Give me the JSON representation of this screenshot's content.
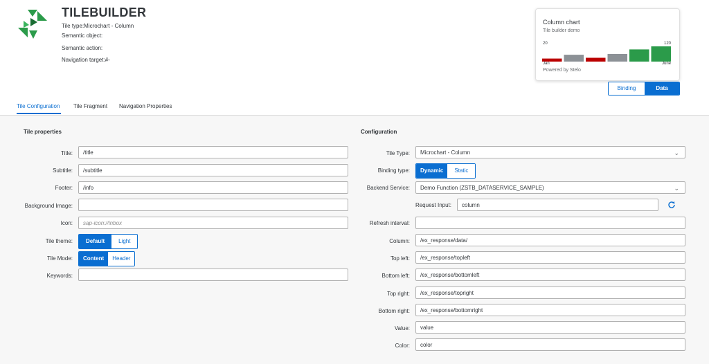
{
  "app": {
    "title": "TILEBUILDER",
    "tile_type": "Tile type:Microchart - Column",
    "semantic_object": "Semantic object:",
    "semantic_action": "Semantic action:",
    "navigation_target": "Navigation target:#-"
  },
  "preview": {
    "title": "Column chart",
    "subtitle": "Tile builder demo",
    "top_left": "20",
    "top_right": "120",
    "bottom_left": "Jan",
    "bottom_right": "June",
    "footer": "Powered by Stelo"
  },
  "chart_data": {
    "type": "bar",
    "values": [
      20,
      45,
      25,
      50,
      80,
      100
    ],
    "colors": [
      "#bb0000",
      "#8c9196",
      "#bb0000",
      "#8c9196",
      "#2b9b4a",
      "#2b9b4a"
    ],
    "ylim": [
      0,
      100
    ]
  },
  "view_toggle": {
    "binding": "Binding",
    "data": "Data",
    "selected": "Data"
  },
  "tabs": [
    {
      "label": "Tile Configuration",
      "active": true
    },
    {
      "label": "Tile Fragment",
      "active": false
    },
    {
      "label": "Navigation Properties",
      "active": false
    }
  ],
  "tile_properties": {
    "section_title": "Tile properties",
    "title_label": "Title:",
    "title_value": "/title",
    "subtitle_label": "Subtitle:",
    "subtitle_value": "/subtitle",
    "footer_label": "Footer:",
    "footer_value": "/info",
    "bg_image_label": "Background Image:",
    "bg_image_value": "",
    "icon_label": "Icon:",
    "icon_placeholder": "sap-icon://inbox",
    "theme_label": "Tile theme:",
    "theme_default": "Default",
    "theme_light": "Light",
    "mode_label": "Tile Mode:",
    "mode_content": "Content",
    "mode_header": "Header",
    "keywords_label": "Keywords:",
    "keywords_value": ""
  },
  "configuration": {
    "section_title": "Configuration",
    "tile_type_label": "Tile Type:",
    "tile_type_value": "Microchart - Column",
    "binding_type_label": "Binding type:",
    "binding_dynamic": "Dynamic",
    "binding_static": "Static",
    "backend_label": "Backend Service:",
    "backend_value": "Demo Function (ZSTB_DATASERVICE_SAMPLE)",
    "request_input_label": "Request Input:",
    "request_input_value": "column",
    "refresh_label": "Refresh interval:",
    "refresh_value": "",
    "column_label": "Column:",
    "column_value": "/ex_response/data/",
    "top_left_label": "Top left:",
    "top_left_value": "/ex_response/topleft",
    "bottom_left_label": "Bottom left:",
    "bottom_left_value": "/ex_response/bottomleft",
    "top_right_label": "Top right:",
    "top_right_value": "/ex_response/topright",
    "bottom_right_label": "Bottom right:",
    "bottom_right_value": "/ex_response/bottomright",
    "value_label": "Value:",
    "value_value": "value",
    "color_label": "Color:",
    "color_value": "color"
  }
}
